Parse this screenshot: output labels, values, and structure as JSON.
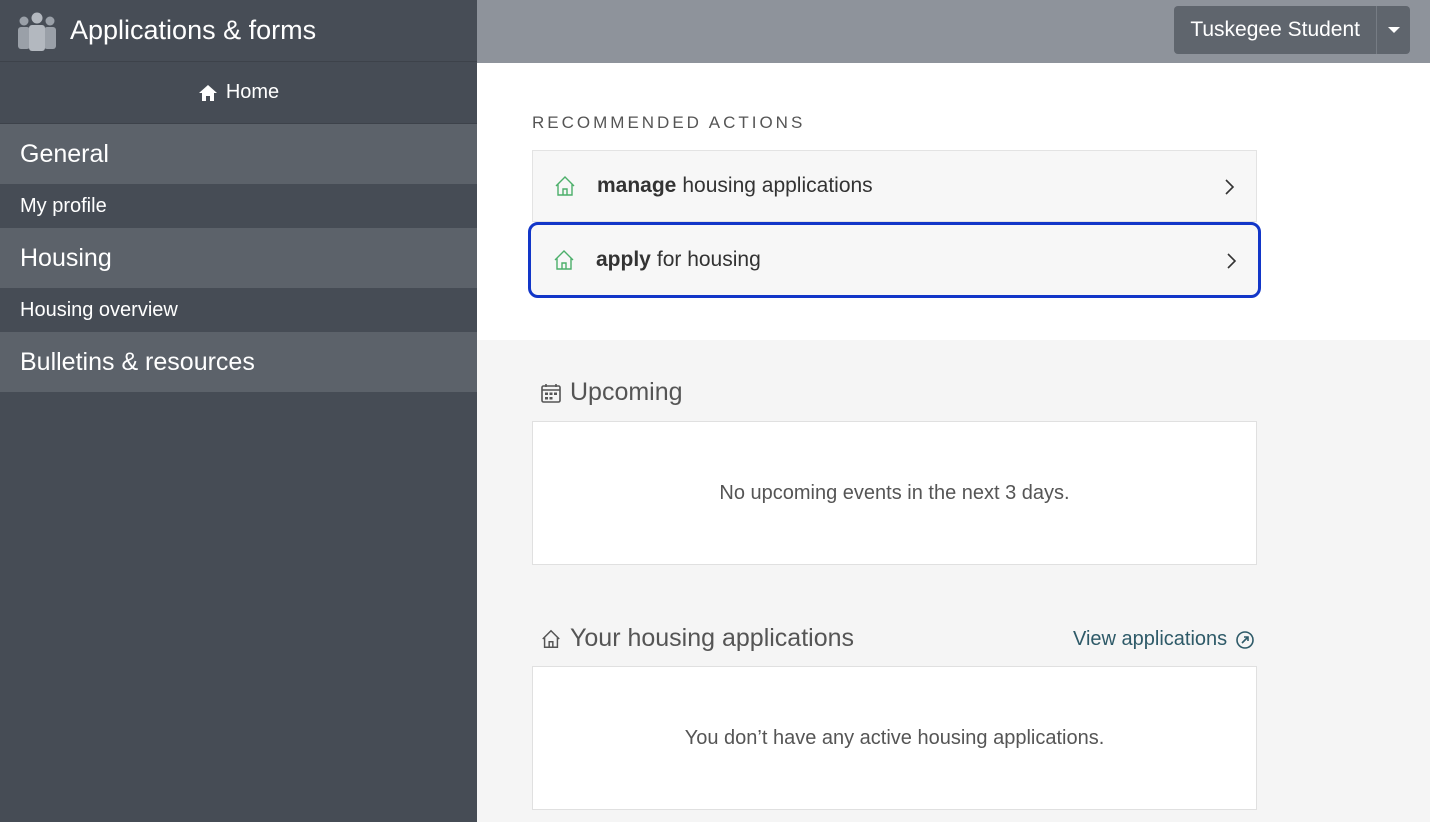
{
  "sidebar": {
    "app_title": "Applications & forms",
    "home_label": "Home",
    "sections": [
      {
        "label": "General",
        "items": [
          "My profile"
        ]
      },
      {
        "label": "Housing",
        "items": [
          "Housing overview"
        ]
      },
      {
        "label": "Bulletins & resources",
        "items": []
      }
    ]
  },
  "topbar": {
    "user_name": "Tuskegee Student"
  },
  "recommended": {
    "heading": "RECOMMENDED ACTIONS",
    "actions": [
      {
        "verb": "manage",
        "rest": "housing applications",
        "icon": "house-icon"
      },
      {
        "verb": "apply",
        "rest": "for housing",
        "icon": "house-icon"
      }
    ]
  },
  "upcoming": {
    "title": "Upcoming",
    "empty_text": "No upcoming events in the next 3 days."
  },
  "housing_apps": {
    "title": "Your housing applications",
    "view_link": "View applications",
    "empty_text": "You don’t have any active housing applications."
  },
  "colors": {
    "sidebar_bg": "#464c55",
    "section_bg": "#5c626a",
    "topbar_bg": "#8e939b",
    "focus_ring": "#1236c8",
    "house_icon": "#4caf6a"
  }
}
